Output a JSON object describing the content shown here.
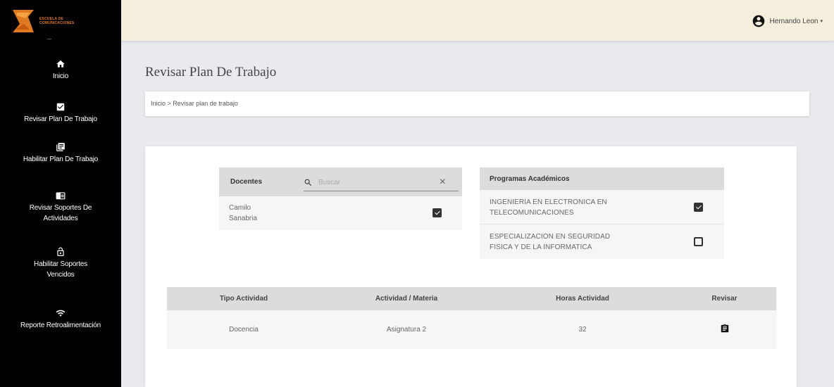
{
  "sidebar": {
    "logo": {
      "line1": "ESCUELA DE",
      "line2": "COMUNICACIONES"
    },
    "items": [
      {
        "icon": "home-icon",
        "label": "Inicio"
      },
      {
        "icon": "checkbox-icon",
        "label": "Revisar Plan De Trabajo"
      },
      {
        "icon": "library-icon",
        "label": "Habilitar Plan De Trabajo"
      },
      {
        "icon": "chrome-reader-icon",
        "label1": "Revisar Soportes De",
        "label2": "Actividades"
      },
      {
        "icon": "lock-open-icon",
        "label1": "Habilitar Soportes",
        "label2": "Vencidos"
      },
      {
        "icon": "wifi-icon",
        "label": "Reporte Retroalimentación"
      }
    ]
  },
  "header": {
    "user": {
      "name": "Hernando Leon",
      "icon": "account-circle-icon",
      "caret": "▾"
    }
  },
  "page": {
    "title": "Revisar Plan De Trabajo",
    "breadcrumb": {
      "home": "Inicio",
      "separator": " > ",
      "current": "Revisar plan de trabajo"
    }
  },
  "docentes": {
    "header": "Docentes",
    "search": {
      "placeholder": "Buscar",
      "value": ""
    },
    "clear": "×",
    "rows": [
      {
        "name_line1": "Camilo",
        "name_line2": "Sanabria",
        "checked": true
      }
    ]
  },
  "programas": {
    "header": "Programas Académicos",
    "rows": [
      {
        "line1": "INGENIERIA EN ELECTRONICA EN",
        "line2": "TELECOMUNICACIONES",
        "checked": true
      },
      {
        "line1": "ESPECIALIZACION EN SEGURIDAD",
        "line2": "FISICA Y DE LA INFORMATICA",
        "checked": false
      }
    ]
  },
  "table": {
    "columns": [
      "Tipo Actividad",
      "Actividad / Materia",
      "Horas Actividad",
      "Revisar"
    ],
    "rows": [
      {
        "tipo": "Docencia",
        "actividad": "Asignatura 2",
        "horas": "32",
        "review_icon": "assignment-icon"
      }
    ]
  },
  "colors": {
    "sidebar_bg": "#000000",
    "topbar_bg": "#f4eedc",
    "logo_accent": "#e07a20",
    "page_bg": "#e8eaed"
  }
}
